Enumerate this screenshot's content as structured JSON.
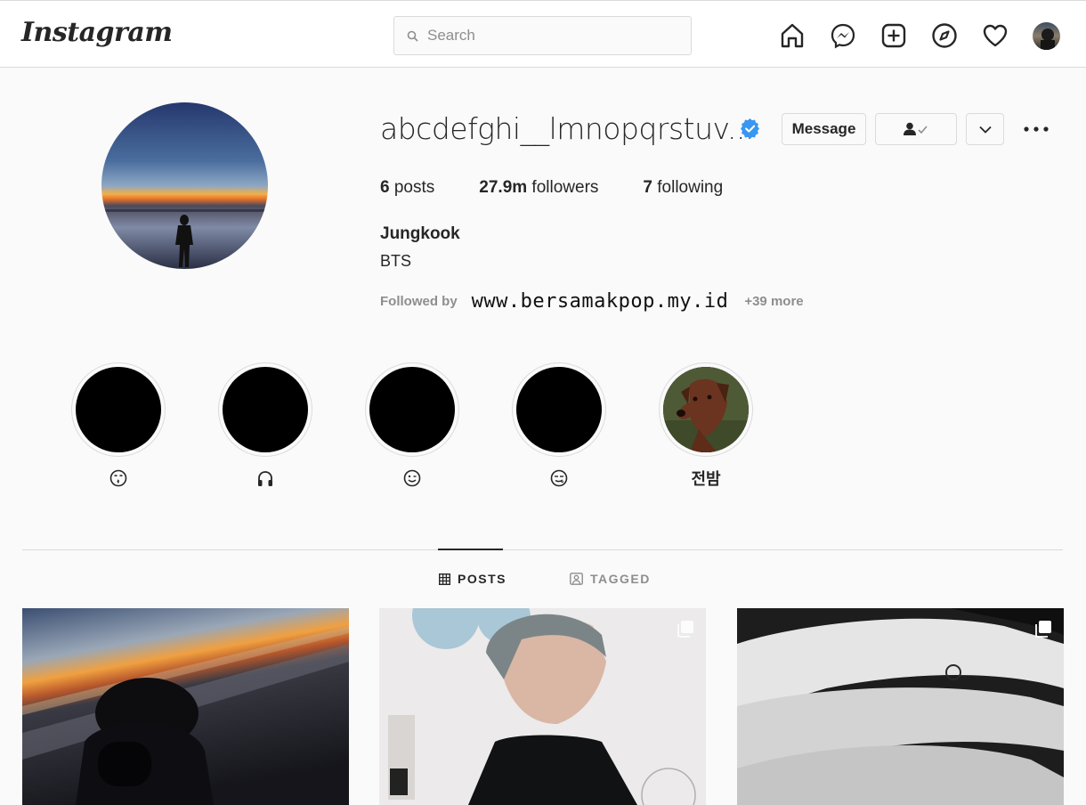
{
  "nav": {
    "logo": "Instagram",
    "search_placeholder": "Search",
    "icons": [
      "home-icon",
      "messenger-icon",
      "new-post-icon",
      "explore-icon",
      "activity-heart-icon",
      "profile-avatar"
    ]
  },
  "profile": {
    "username": "abcdefghi__lmnopqrstuv...",
    "verified": true,
    "message_label": "Message",
    "stats": {
      "posts_count": "6",
      "posts_label": " posts",
      "followers_count": "27.9m",
      "followers_label": " followers",
      "following_count": "7",
      "following_label": " following"
    },
    "full_name": "Jungkook",
    "bio": "BTS",
    "followed_by_label": "Followed by",
    "followed_by_watermark": "www.bersamakpop.my.id",
    "followed_by_more": "+39 more"
  },
  "highlights": [
    {
      "label_icon": "kissing-face-icon",
      "label": ""
    },
    {
      "label_icon": "headphones-icon",
      "label": ""
    },
    {
      "label_icon": "wink-face-icon",
      "label": ""
    },
    {
      "label_icon": "smirk-face-icon",
      "label": ""
    },
    {
      "label_icon": "",
      "label": "전밤"
    }
  ],
  "tabs": [
    {
      "label": "POSTS",
      "active": true
    },
    {
      "label": "TAGGED",
      "active": false
    }
  ],
  "colors": {
    "background": "#fafafa",
    "border": "#dbdbdb",
    "verified_blue": "#3897f0",
    "text": "#262626",
    "muted": "#8e8e8e"
  }
}
